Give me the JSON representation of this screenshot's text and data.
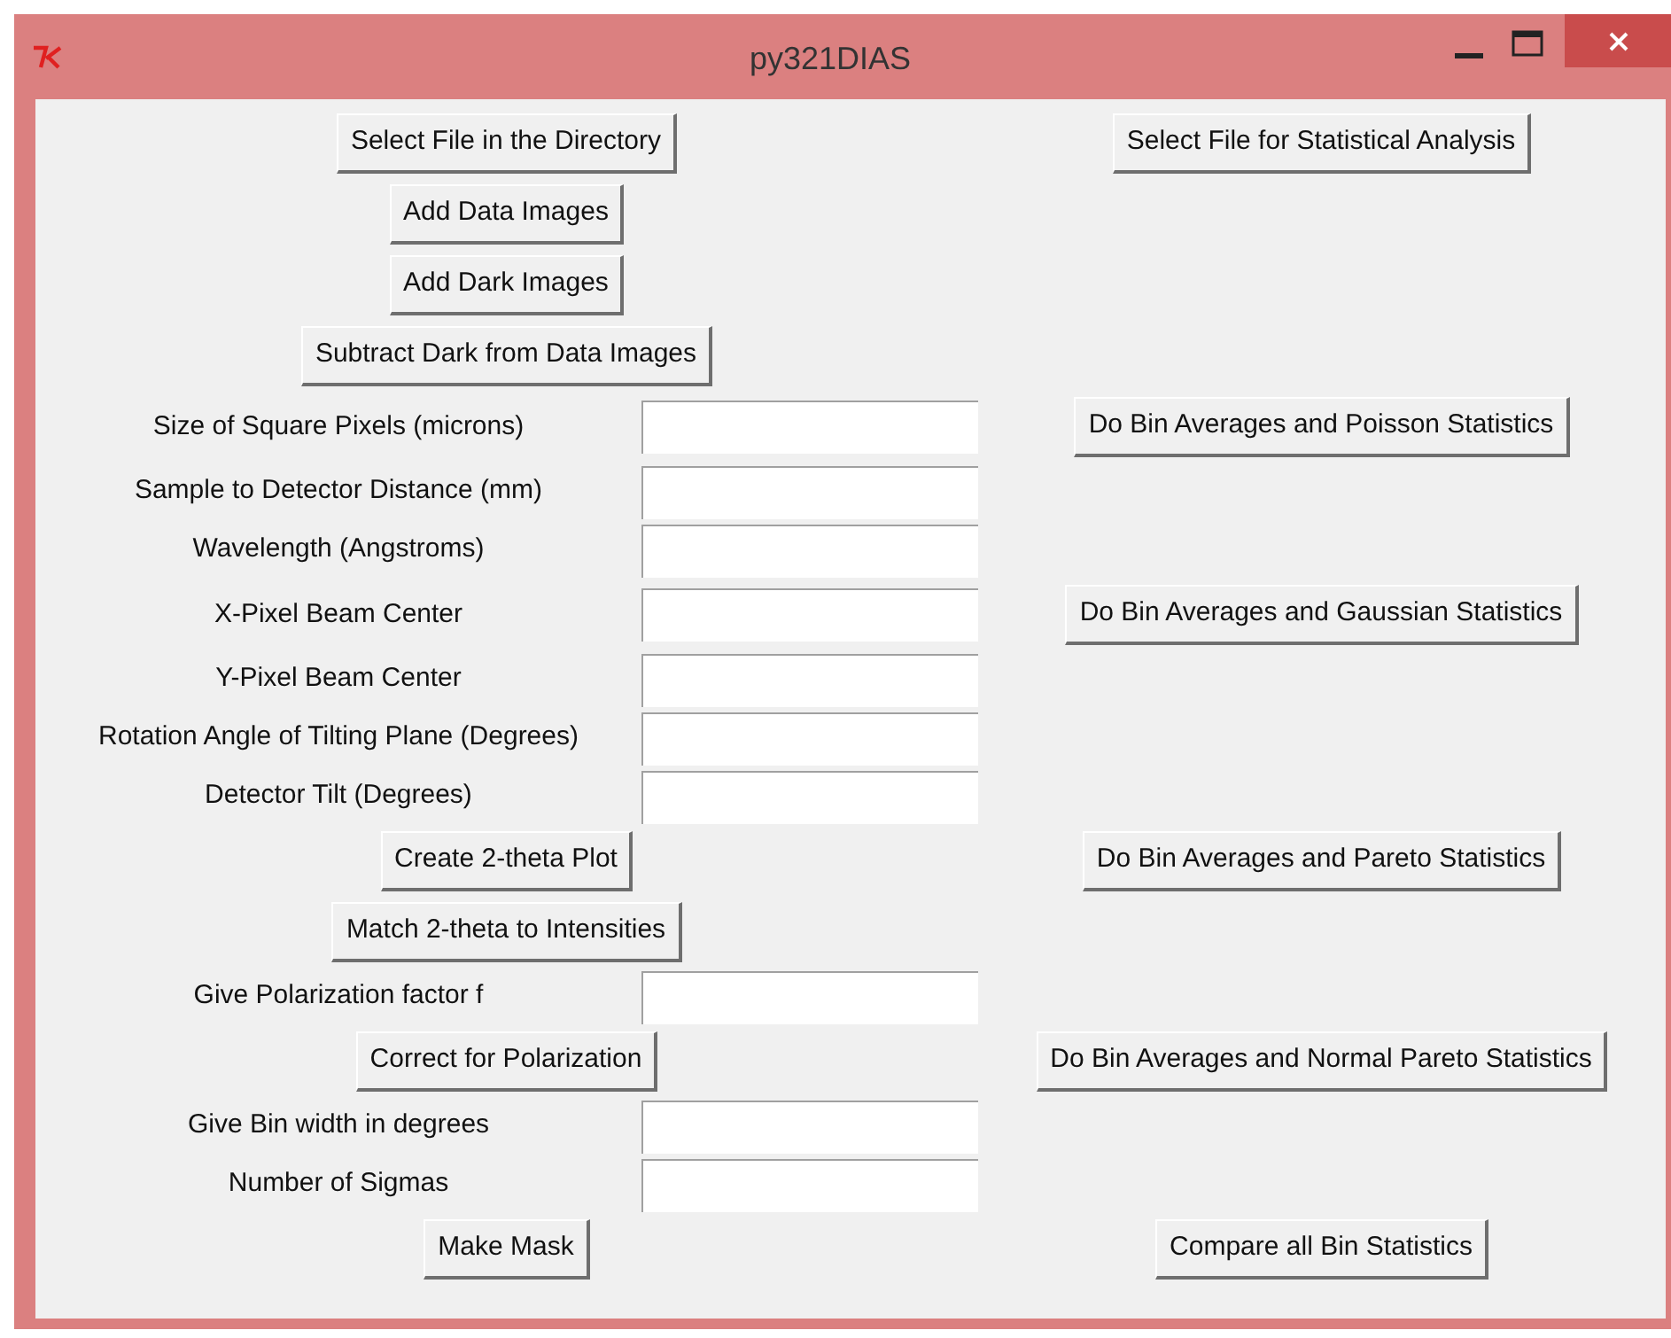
{
  "window": {
    "title": "py321DIAS"
  },
  "rows": [
    {
      "kind": "button",
      "text": "Select File in the Directory",
      "right": "Select File for Statistical Analysis"
    },
    {
      "kind": "button",
      "text": "Add Data Images"
    },
    {
      "kind": "button",
      "text": "Add Dark Images"
    },
    {
      "kind": "button",
      "text": "Subtract Dark from Data Images"
    },
    {
      "kind": "field",
      "text": "Size of Square Pixels (microns)",
      "right": "Do Bin Averages and Poisson Statistics"
    },
    {
      "kind": "field",
      "text": "Sample to Detector Distance (mm)"
    },
    {
      "kind": "field",
      "text": "Wavelength (Angstroms)"
    },
    {
      "kind": "field",
      "text": "X-Pixel Beam Center",
      "right": "Do Bin Averages and Gaussian Statistics"
    },
    {
      "kind": "field",
      "text": "Y-Pixel Beam Center"
    },
    {
      "kind": "field",
      "text": "Rotation Angle of Tilting Plane (Degrees)"
    },
    {
      "kind": "field",
      "text": "Detector Tilt (Degrees)"
    },
    {
      "kind": "button",
      "text": "Create 2-theta Plot",
      "right": "Do Bin Averages and Pareto Statistics"
    },
    {
      "kind": "button",
      "text": "Match 2-theta to Intensities"
    },
    {
      "kind": "field",
      "text": "Give Polarization factor f"
    },
    {
      "kind": "button",
      "text": "Correct for Polarization",
      "right": "Do Bin Averages and Normal Pareto Statistics"
    },
    {
      "kind": "field",
      "text": "Give Bin width in degrees"
    },
    {
      "kind": "field",
      "text": "Number of Sigmas"
    },
    {
      "kind": "button",
      "text": "Make Mask",
      "right": "Compare all Bin Statistics"
    }
  ]
}
